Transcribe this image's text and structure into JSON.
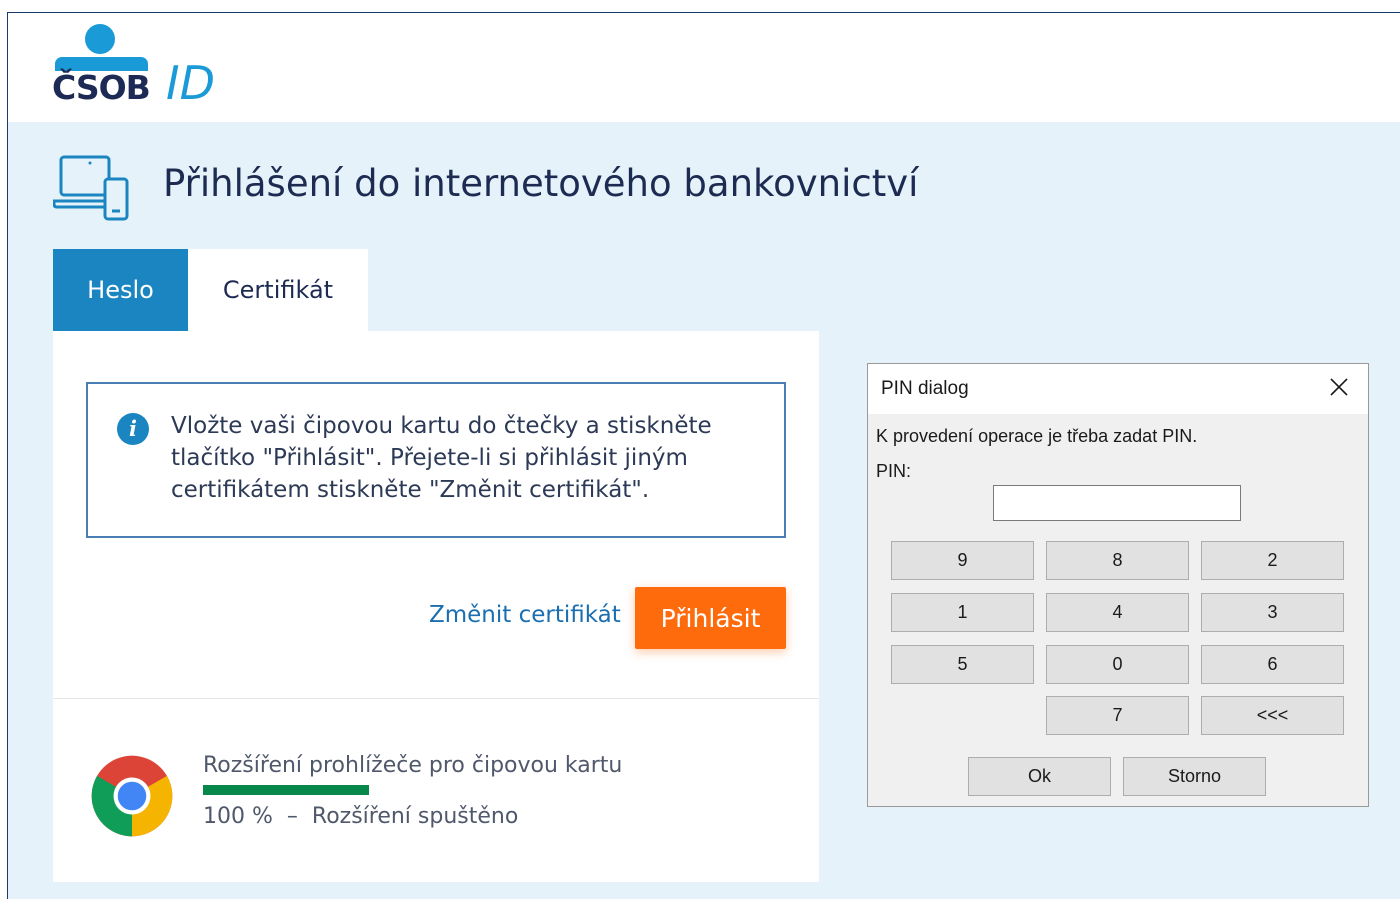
{
  "header": {
    "logo_text": "ČSOB",
    "logo_id": "ID",
    "brand_color": "#1a9ad6"
  },
  "page": {
    "title": "Přihlášení do internetového bankovnictví"
  },
  "tabs": [
    {
      "label": "Heslo",
      "active": true
    },
    {
      "label": "Certifikát",
      "active": false
    }
  ],
  "info": {
    "icon": "info-icon",
    "text": "Vložte vaši čipovou kartu do čtečky a stiskněte tlačítko \"Přihlásit\". Přejete-li si přihlásit jiným certifikátem stiskněte \"Změnit certifikát\"."
  },
  "actions": {
    "change_cert": "Změnit certifikát",
    "login": "Přihlásit"
  },
  "extension": {
    "icon": "chrome-icon",
    "title": "Rozšíření prohlížeče pro čipovou kartu",
    "progress_label": "100 %",
    "separator": "–",
    "status": "Rozšíření spuštěno",
    "progress": 1.0
  },
  "pin_dialog": {
    "title": "PIN dialog",
    "message": "K provedení operace je třeba zadat PIN.",
    "pin_label": "PIN:",
    "pin_value": "",
    "keys": [
      "9",
      "8",
      "2",
      "1",
      "4",
      "3",
      "5",
      "0",
      "6",
      "7",
      "<<<"
    ],
    "ok": "Ok",
    "cancel": "Storno"
  },
  "colors": {
    "accent": "#1a85c0",
    "login_button": "#fe6b0c",
    "background": "#e5f2f9",
    "progress": "#07874a"
  }
}
